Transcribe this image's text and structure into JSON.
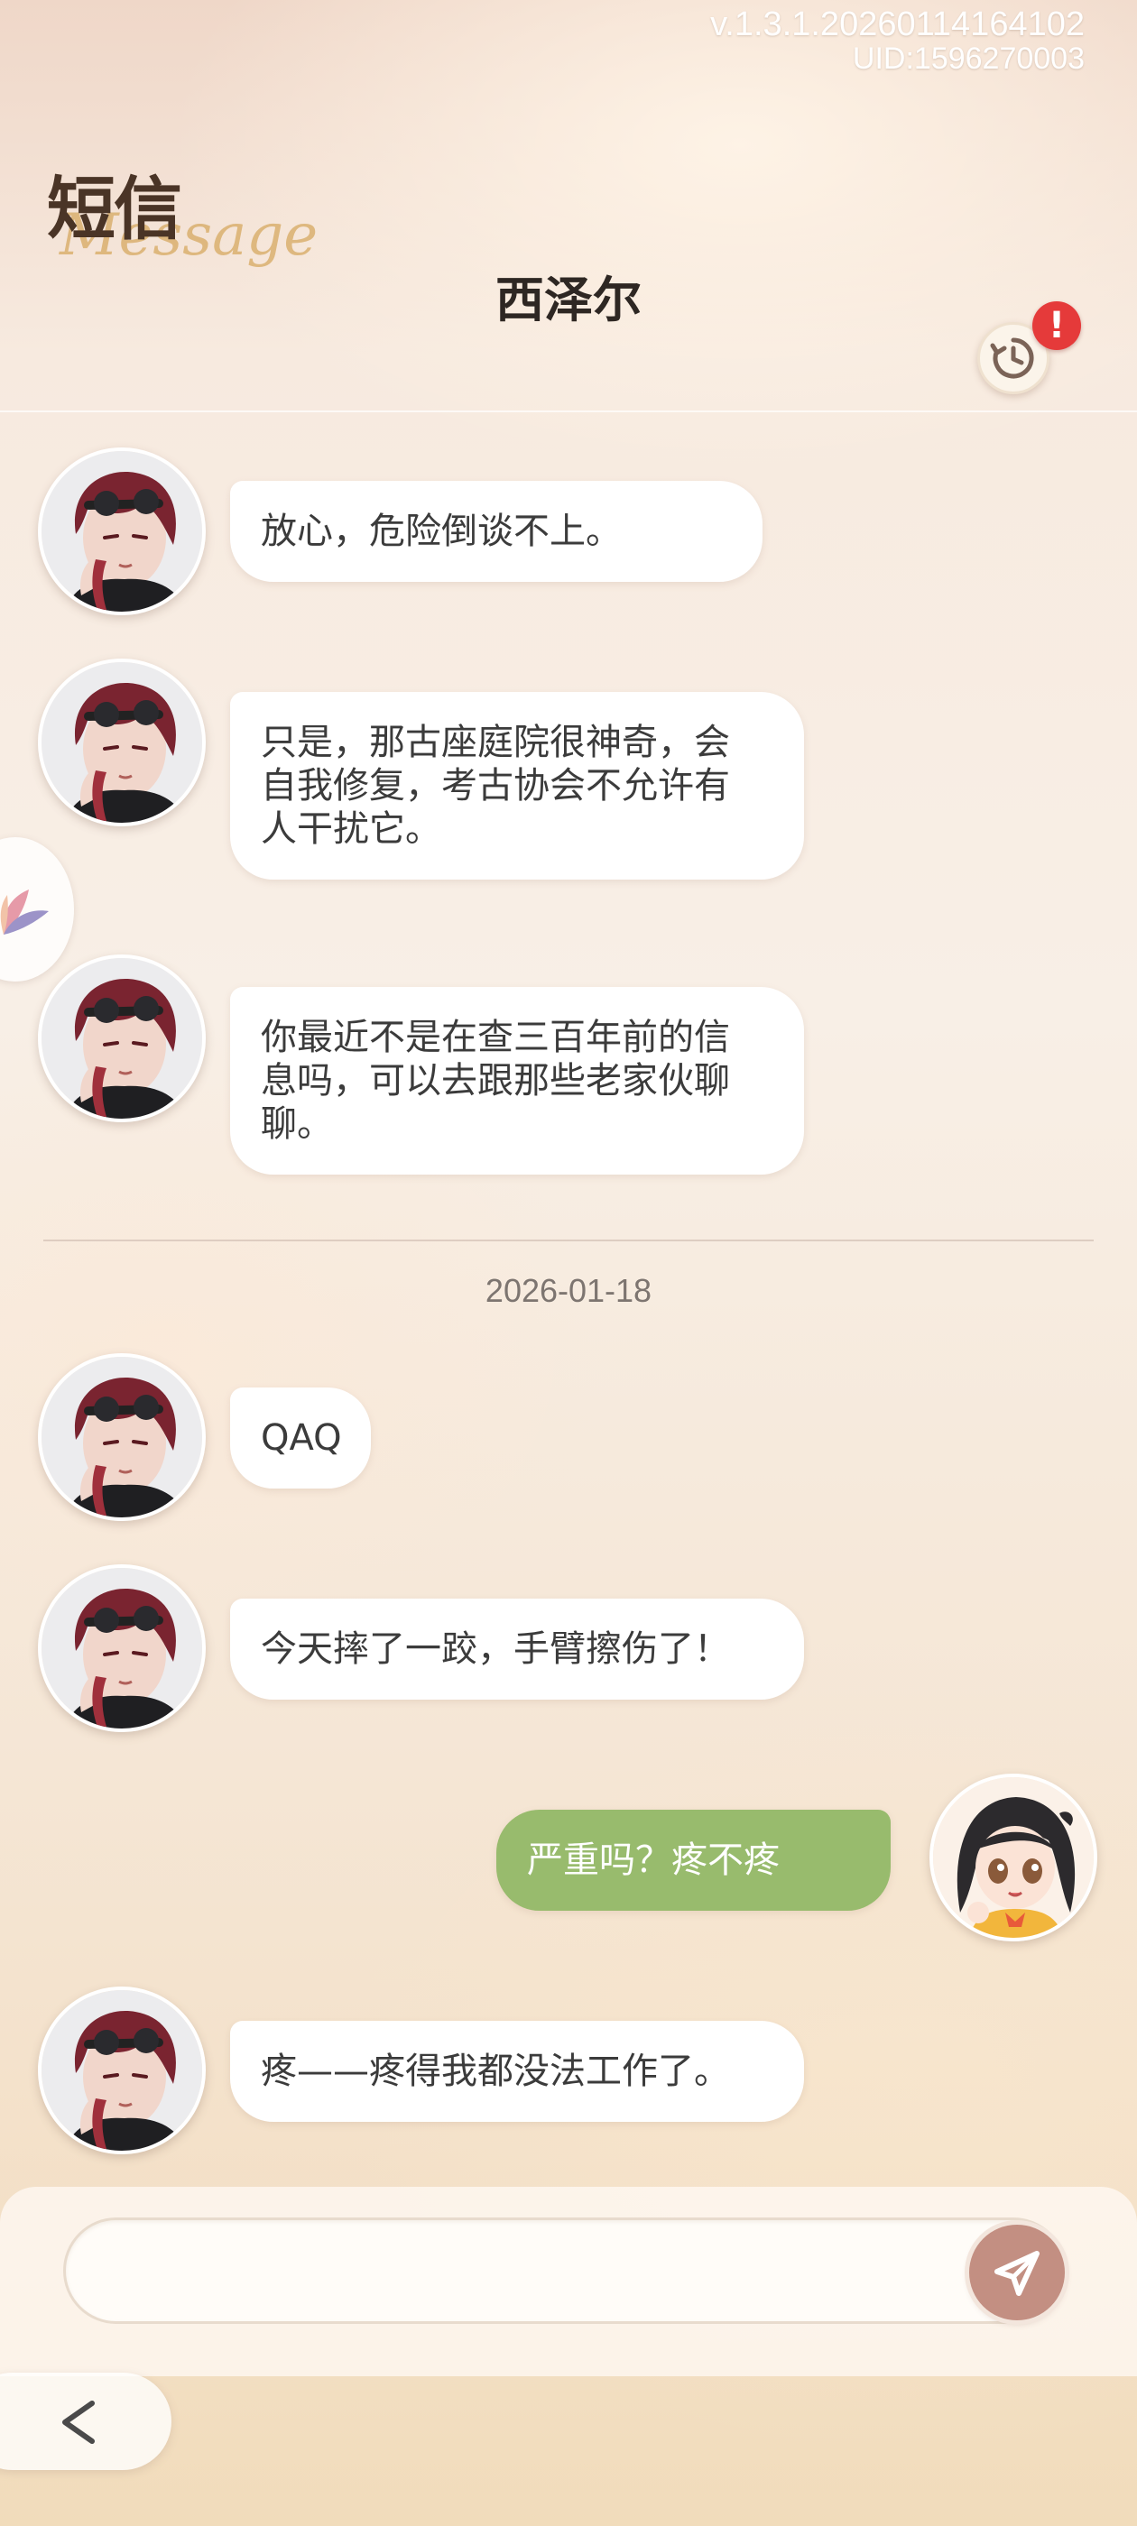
{
  "status": {
    "version": "v.1.3.1.20260114164102",
    "uid": "UID:1596270003"
  },
  "header": {
    "app_title": "短信",
    "app_subtitle": "Message",
    "contact_name": "西泽尔",
    "history_icon": "clock-history-icon",
    "alert_badge": "!"
  },
  "messages_before": [
    {
      "sender": "contact",
      "text": "放心，危险倒谈不上。"
    },
    {
      "sender": "contact",
      "text": "只是，那古座庭院很神奇，会\n自我修复，考古协会不允许有\n人干扰它。"
    },
    {
      "sender": "contact",
      "text": "你最近不是在查三百年前的信\n息吗，可以去跟那些老家伙聊\n聊。"
    }
  ],
  "date_divider": "2026-01-18",
  "messages_after": [
    {
      "sender": "contact",
      "text": "QAQ"
    },
    {
      "sender": "contact",
      "text": "今天摔了一跤，手臂擦伤了！"
    },
    {
      "sender": "me",
      "text": "严重吗？疼不疼"
    },
    {
      "sender": "contact",
      "text": "疼——疼得我都没法工作了。"
    }
  ],
  "composer": {
    "placeholder": "",
    "send_icon": "paper-plane-icon"
  },
  "navigation": {
    "back_icon": "chevron-left-icon",
    "side_handle_icon": "petal-fan-icon"
  },
  "colors": {
    "my_bubble": "#98bb6d",
    "their_bubble": "#ffffff",
    "alert": "#e53a3a",
    "send_button": "#c38f82"
  }
}
